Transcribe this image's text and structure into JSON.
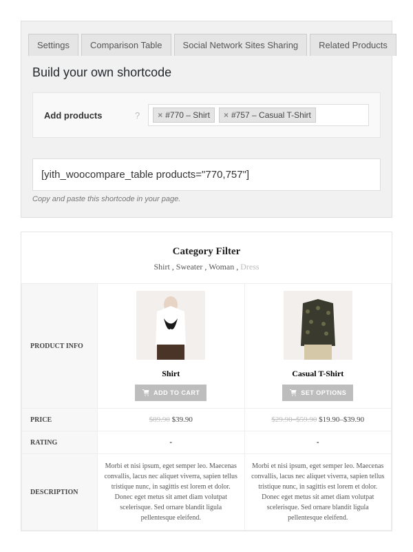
{
  "tabs": {
    "settings": "Settings",
    "comparison": "Comparison Table",
    "social": "Social Network Sites Sharing",
    "related": "Related Products"
  },
  "section_title": "Build your own shortcode",
  "field": {
    "label": "Add products",
    "tags": {
      "a": "#770 – Shirt",
      "b": "#757 – Casual T-Shirt"
    }
  },
  "shortcode": "[yith_woocompare_table products=\"770,757\"]",
  "hint": "Copy and paste this shortcode in your page.",
  "category": {
    "title": "Category Filter",
    "links": "Shirt , Sweater , Woman ,",
    "dim": " Dress"
  },
  "table": {
    "headers": {
      "info": "PRODUCT INFO",
      "price": "PRICE",
      "rating": "RATING",
      "description": "DESCRIPTION"
    },
    "products": {
      "a": {
        "name": "Shirt",
        "button": "ADD TO CART",
        "price_old": "$89.90",
        "price_new": " $39.90",
        "rating": "-",
        "description": "Morbi et nisi ipsum, eget semper leo. Maecenas convallis, lacus nec aliquet viverra, sapien tellus tristique nunc, in sagittis est lorem et dolor. Donec eget metus sit amet diam volutpat scelerisque. Sed ornare blandit ligula pellentesque eleifend."
      },
      "b": {
        "name": "Casual T-Shirt",
        "button": "SET OPTIONS",
        "price_old": "$29.90–$59.90",
        "price_new": " $19.90–$39.90",
        "rating": "-",
        "description": "Morbi et nisi ipsum, eget semper leo. Maecenas convallis, lacus nec aliquet viverra, sapien tellus tristique nunc, in sagittis est lorem et dolor. Donec eget metus sit amet diam volutpat scelerisque. Sed ornare blandit ligula pellentesque eleifend."
      }
    }
  }
}
